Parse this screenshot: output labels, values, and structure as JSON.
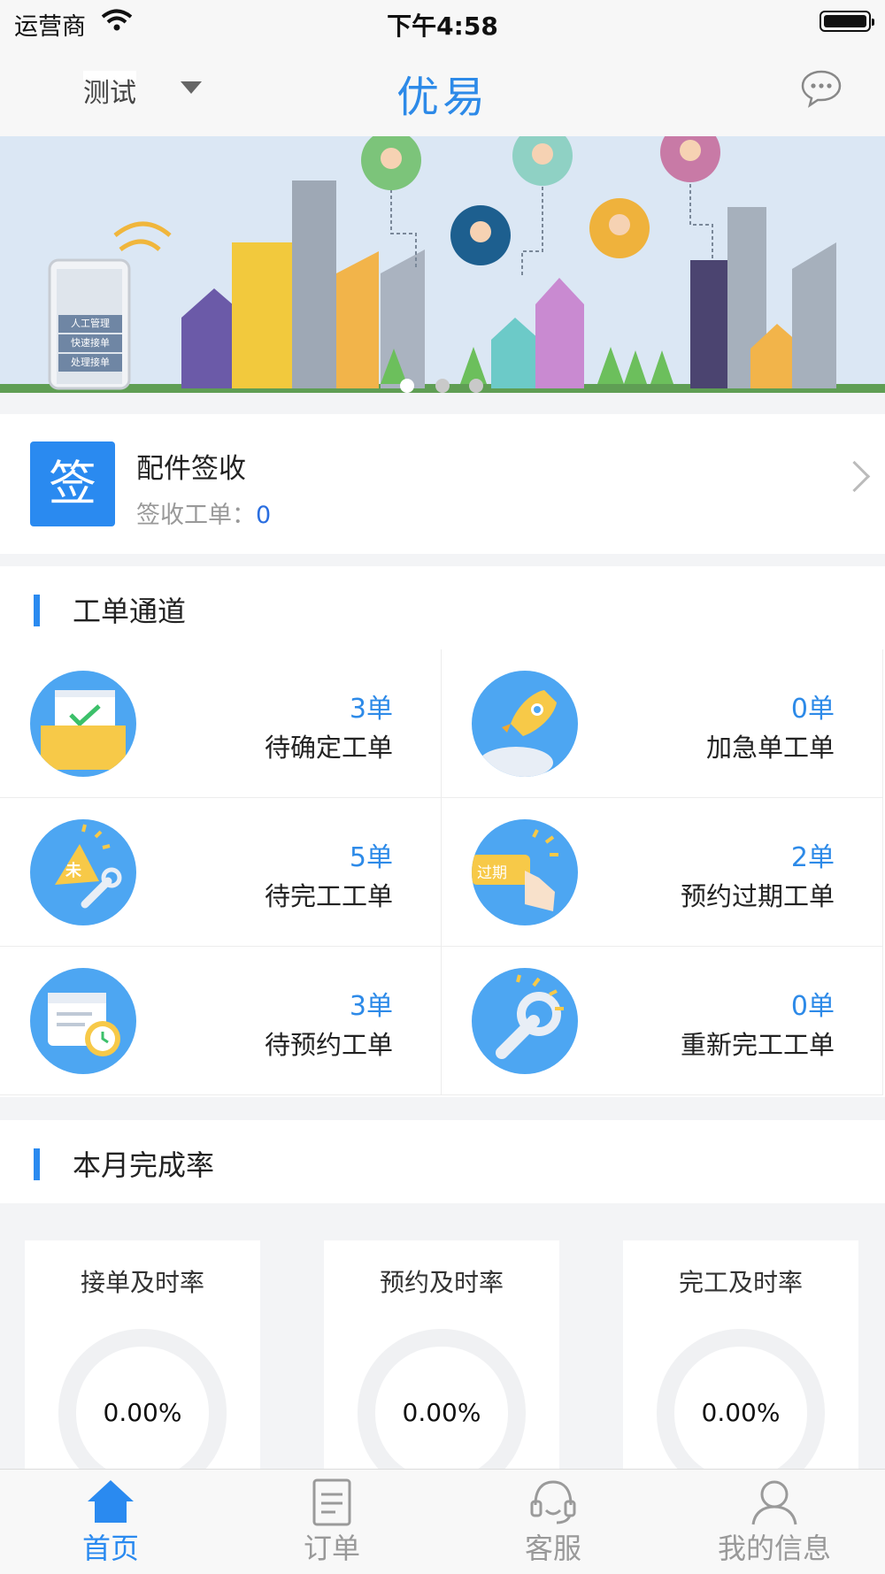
{
  "status_bar": {
    "carrier": "运营商",
    "time": "下午4:58"
  },
  "nav": {
    "city": "测试",
    "title": "优易",
    "message_icon": "chat-bubble-icon"
  },
  "banner": {
    "phone_labels": [
      "人工管理",
      "快速接单",
      "处理接单"
    ],
    "slide_count": 3,
    "active_slide": 1
  },
  "sign_card": {
    "badge": "签",
    "title": "配件签收",
    "subtitle": "签收工单：",
    "count": "0"
  },
  "work_orders": {
    "section_title": "工单通道",
    "items": [
      {
        "count": "3单",
        "name": "待确定工单",
        "icon": "envelope-check-icon"
      },
      {
        "count": "0单",
        "name": "加急单工单",
        "icon": "rocket-icon"
      },
      {
        "count": "5单",
        "name": "待完工工单",
        "icon": "unfinished-wrench-icon",
        "icon_text": "未"
      },
      {
        "count": "2单",
        "name": "预约过期工单",
        "icon": "expired-tap-icon",
        "icon_text": "过期"
      },
      {
        "count": "3单",
        "name": "待预约工单",
        "icon": "calendar-clock-icon"
      },
      {
        "count": "0单",
        "name": "重新完工工单",
        "icon": "wrench-icon"
      }
    ]
  },
  "completion": {
    "section_title": "本月完成率",
    "items": [
      {
        "label": "接单及时率",
        "value": "0.00%"
      },
      {
        "label": "预约及时率",
        "value": "0.00%"
      },
      {
        "label": "完工及时率",
        "value": "0.00%"
      }
    ]
  },
  "tabbar": {
    "items": [
      {
        "label": "首页",
        "icon": "home-icon",
        "active": true
      },
      {
        "label": "订单",
        "icon": "document-icon",
        "active": false
      },
      {
        "label": "客服",
        "icon": "headset-icon",
        "active": false
      },
      {
        "label": "我的信息",
        "icon": "user-icon",
        "active": false
      }
    ]
  },
  "colors": {
    "accent": "#2a8af0",
    "icon_bg": "#4da6f2",
    "page_bg": "#f3f4f6"
  }
}
